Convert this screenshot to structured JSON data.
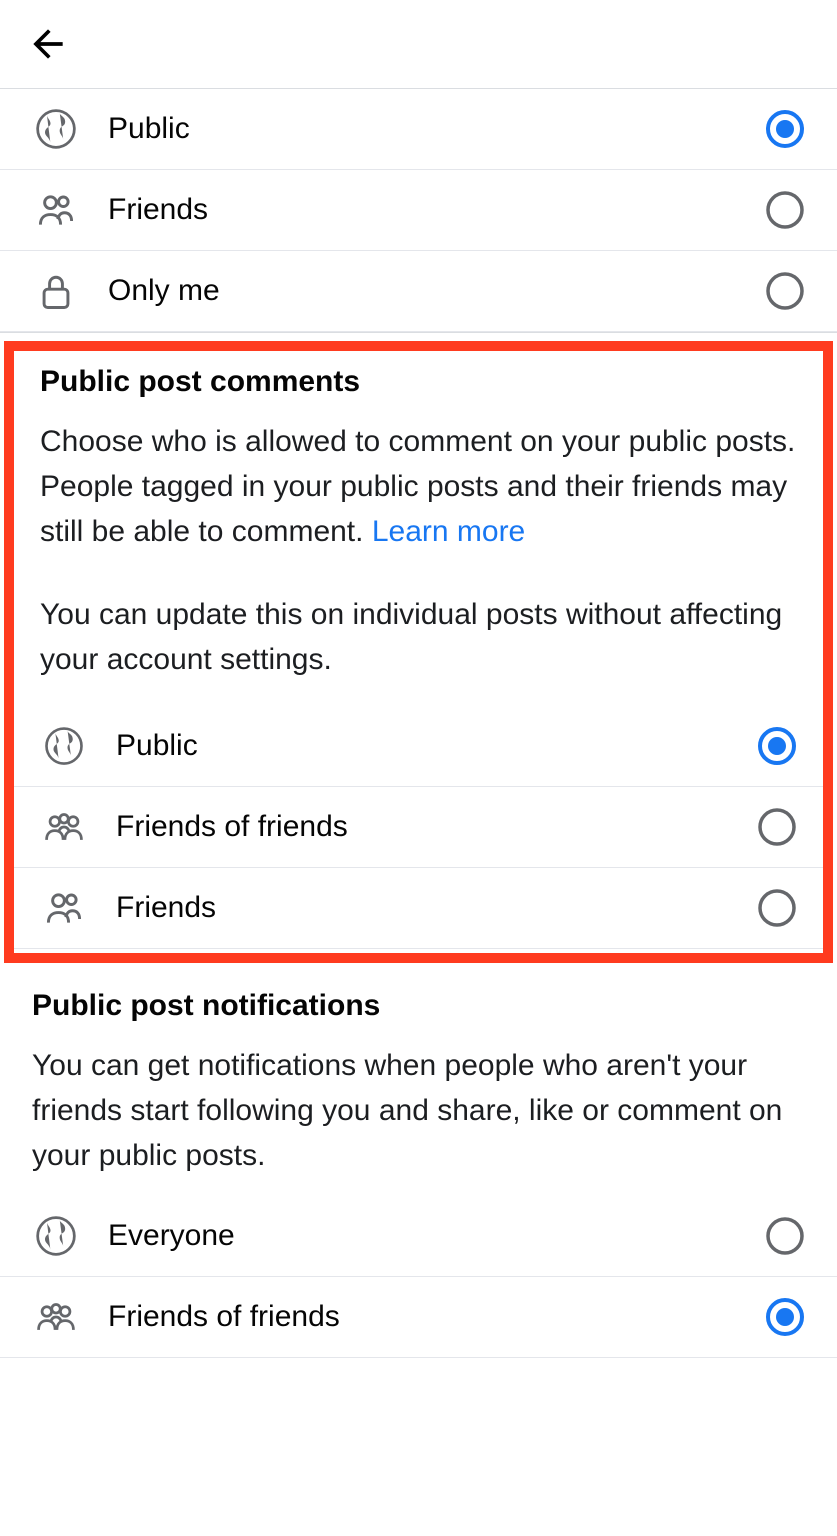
{
  "section1": {
    "options": [
      {
        "label": "Public",
        "icon": "globe",
        "selected": true
      },
      {
        "label": "Friends",
        "icon": "friends",
        "selected": false
      },
      {
        "label": "Only me",
        "icon": "lock",
        "selected": false
      }
    ]
  },
  "section2": {
    "title": "Public post comments",
    "description_part1": "Choose who is allowed to comment on your public posts. People tagged in your public posts and their friends may still be able to comment. ",
    "learn_more": "Learn more",
    "description_part2": "You can update this on individual posts without affecting your account settings.",
    "options": [
      {
        "label": "Public",
        "icon": "globe",
        "selected": true
      },
      {
        "label": "Friends of friends",
        "icon": "friends-of-friends",
        "selected": false
      },
      {
        "label": "Friends",
        "icon": "friends",
        "selected": false
      }
    ]
  },
  "section3": {
    "title": "Public post notifications",
    "description": "You can get notifications when people who aren't your friends start following you and share, like or comment on your public posts.",
    "options": [
      {
        "label": "Everyone",
        "icon": "globe",
        "selected": false
      },
      {
        "label": "Friends of friends",
        "icon": "friends-of-friends",
        "selected": true
      }
    ]
  }
}
